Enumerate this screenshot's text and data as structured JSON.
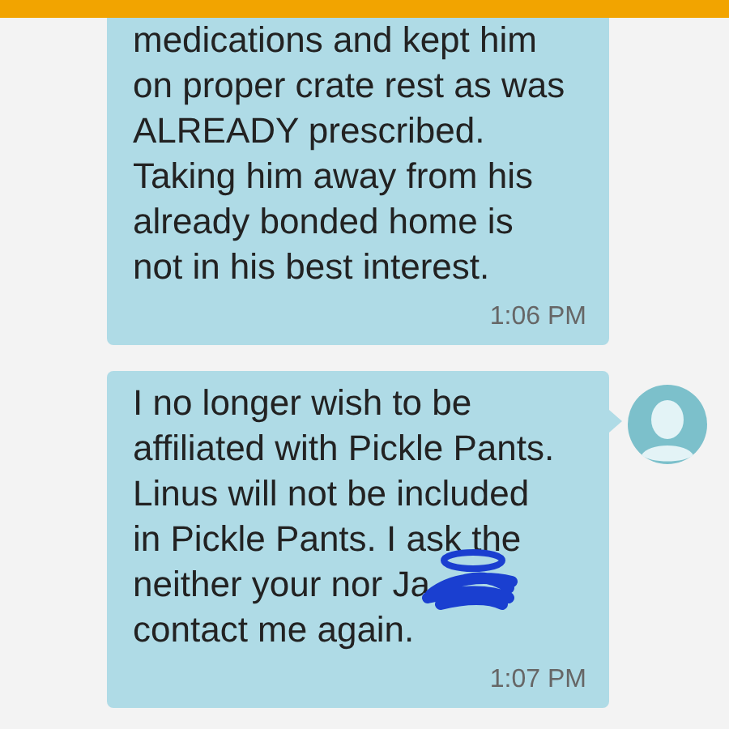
{
  "messages": [
    {
      "lines": [
        "medications and kept him",
        "on proper crate rest as was",
        "ALREADY prescribed.",
        "Taking him away from his",
        "already bonded home is",
        "not in his best interest."
      ],
      "time": "1:06 PM",
      "avatar": false,
      "redacted": false
    },
    {
      "lines": [
        "I no longer wish to be",
        "affiliated with Pickle Pants.",
        "Linus will not be included",
        "in Pickle Pants. I ask the",
        "neither your nor Ja",
        "contact me again."
      ],
      "time": "1:07 PM",
      "avatar": true,
      "redacted": true
    }
  ]
}
